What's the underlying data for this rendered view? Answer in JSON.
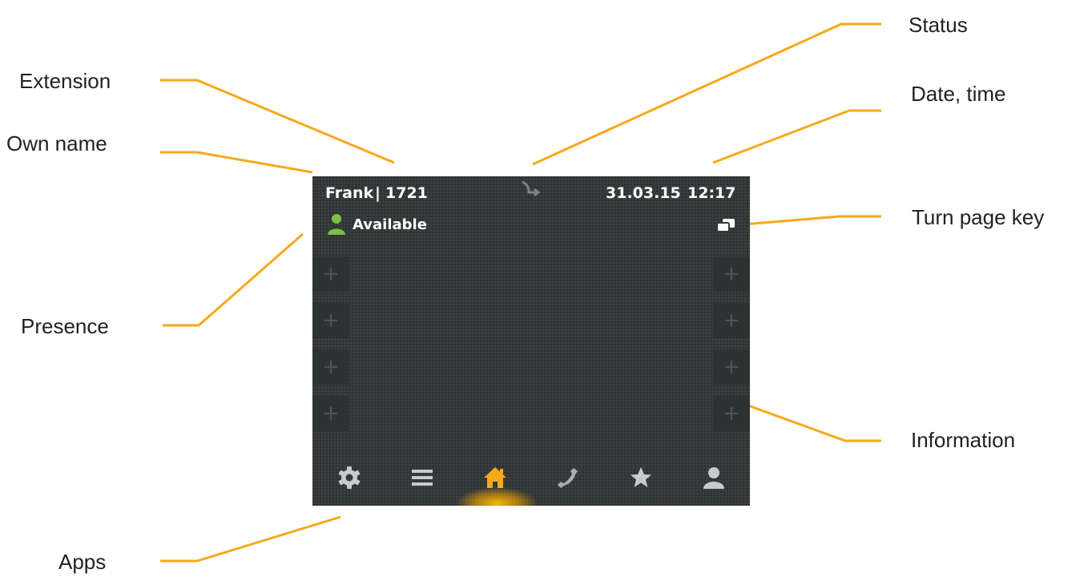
{
  "callouts": {
    "status": "Status",
    "extension": "Extension",
    "date_time": "Date, time",
    "own_name": "Own name",
    "turn_page_key": "Turn page key",
    "presence": "Presence",
    "information": "Information",
    "apps": "Apps"
  },
  "screen": {
    "own_name": "Frank",
    "separator": "|",
    "extension": "1721",
    "date": "31.03.15",
    "time": "12:17",
    "presence": "Available",
    "function_key_symbol": "+"
  },
  "apps": [
    "gear-icon",
    "menu-icon",
    "home-icon",
    "phone-icon",
    "star-icon",
    "contacts-icon"
  ],
  "colors": {
    "leader": "#f7a81b",
    "screen_bg": "#34393a",
    "presence_green": "#7ac143",
    "active_app": "#f7a81b",
    "icon_gray": "#c8cbcc"
  }
}
